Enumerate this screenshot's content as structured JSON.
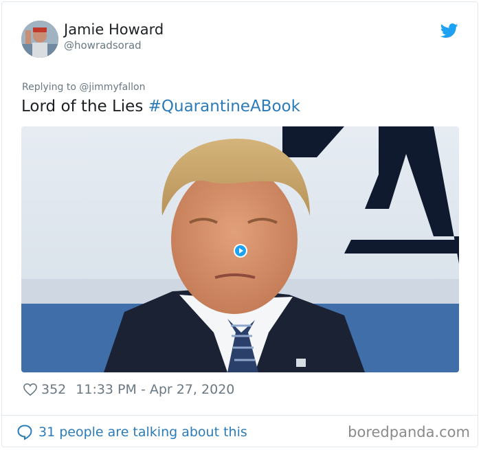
{
  "author": {
    "name": "Jamie Howard",
    "handle": "@howradsorad",
    "avatar_icon": "user-avatar"
  },
  "reply": {
    "prefix": "Replying to",
    "mention": "@jimmyfallon"
  },
  "tweet": {
    "text": "Lord of the Lies",
    "hashtag": "#QuarantineABook"
  },
  "media": {
    "type": "video",
    "play_icon": "play-icon"
  },
  "meta": {
    "likes": "352",
    "timestamp": "11:33 PM - Apr 27, 2020"
  },
  "footer": {
    "talking": "31 people are talking about this",
    "watermark": "boredpanda.com"
  },
  "colors": {
    "link": "#2b7bb9",
    "muted": "#697882",
    "twitter_blue": "#1da1f2"
  }
}
